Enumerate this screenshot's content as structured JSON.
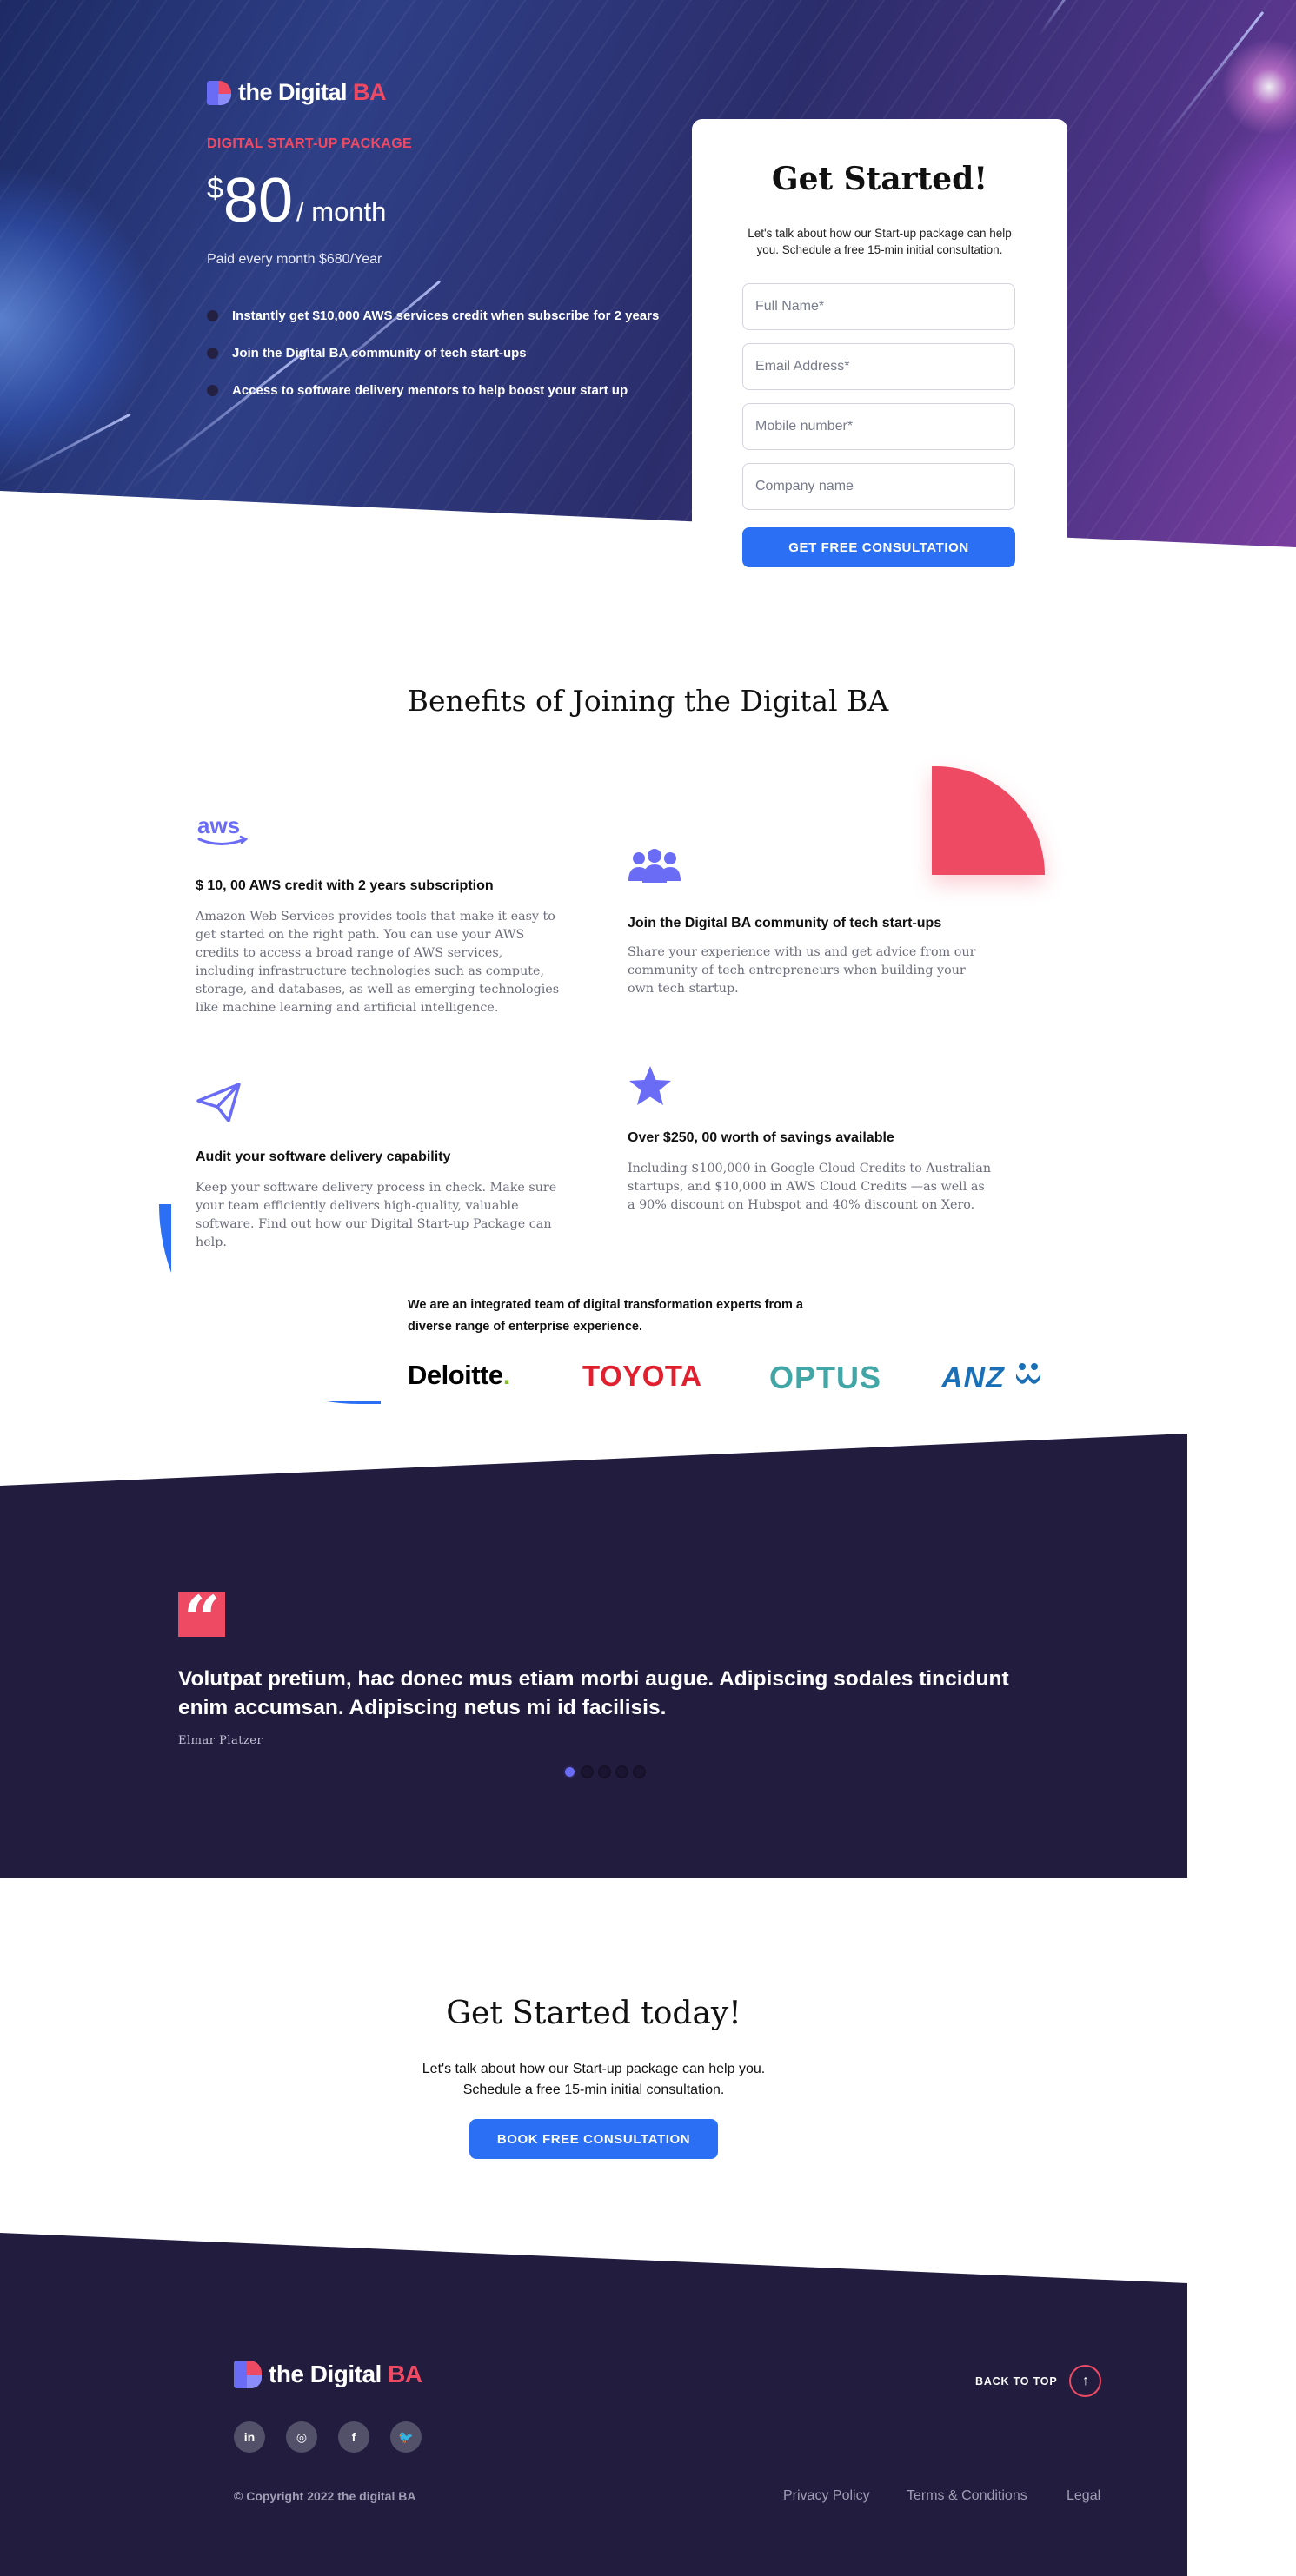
{
  "brand": {
    "name_main": "the Digital ",
    "name_accent": "BA"
  },
  "hero": {
    "eyebrow": "DIGITAL START-UP PACKAGE",
    "currency": "$",
    "amount": "80",
    "period": "/ month",
    "paid_note": "Paid every month $680/Year",
    "bullets": [
      "Instantly get $10,000 AWS services credit when subscribe for 2 years",
      "Join the Digital BA community of tech start-ups",
      "Access to software delivery mentors to help boost your start up"
    ]
  },
  "form": {
    "title": "Get Started!",
    "intro": "Let's talk about how our Start-up package can help you. Schedule a free 15-min initial consultation.",
    "full_name_placeholder": "Full Name*",
    "email_placeholder": "Email Address*",
    "mobile_placeholder": "Mobile number*",
    "company_placeholder": "Company name",
    "submit_label": "GET FREE CONSULTATION"
  },
  "benefits": {
    "title": "Benefits of Joining the Digital BA",
    "items": [
      {
        "icon": "aws-icon",
        "title": "$ 10, 00 AWS credit with 2 years subscription",
        "text": "Amazon Web Services provides tools that make it easy to get started on the right path. You can use your AWS credits to access a broad range of AWS services, including infrastructure technologies such as compute, storage, and databases, as well as emerging technologies like machine learning and artificial intelligence."
      },
      {
        "icon": "users-icon",
        "title": "Join the Digital BA community of tech start-ups",
        "text": "Share your experience with us and get advice from our community of tech entrepreneurs when building your own tech startup."
      },
      {
        "icon": "paper-plane-icon",
        "title": "Audit your software delivery capability",
        "text": "Keep your software delivery process in check. Make sure your team efficiently delivers high-quality, valuable software. Find out how our Digital Start-up Package can help."
      },
      {
        "icon": "star-icon",
        "title": "Over $250, 00 worth of savings available",
        "text": "Including $100,000 in Google Cloud Credits to Australian startups, and $10,000 in AWS Cloud Credits —as well as a 90% discount on Hubspot and 40% discount on Xero."
      }
    ]
  },
  "partners": {
    "text": "We are an integrated team of digital transformation experts from a diverse range of enterprise experience.",
    "logos": [
      "Deloitte",
      ".",
      "TOYOTA",
      "OPTUS",
      "ANZ"
    ]
  },
  "testimonial": {
    "quote": "Volutpat pretium, hac donec mus etiam morbi augue. Adipiscing sodales tincidunt enim accumsan. Adipiscing netus mi id facilisis.",
    "author": "Elmar Platzer",
    "slide_count": 5,
    "active_slide": 1
  },
  "cta": {
    "title": "Get Started today!",
    "line1": "Let's talk about how our Start-up package can help you.",
    "line2": "Schedule a free 15-min initial consultation.",
    "button": "BOOK FREE CONSULTATION"
  },
  "footer": {
    "back_to_top": "BACK TO TOP",
    "back_to_top_arrow": "↑",
    "socials": [
      {
        "name": "linkedin-icon",
        "glyph": "in"
      },
      {
        "name": "instagram-icon",
        "glyph": "◎"
      },
      {
        "name": "facebook-icon",
        "glyph": "f"
      },
      {
        "name": "twitter-icon",
        "glyph": "🐦"
      }
    ],
    "copyright": "© Copyright 2022 the digital BA",
    "links": [
      "Privacy Policy",
      "Terms & Conditions",
      "Legal"
    ]
  },
  "colors": {
    "accent_red": "#ef4a63",
    "primary_blue": "#2b6ff5",
    "icon_purple": "#6a6cf6",
    "dark_navy": "#221c3e"
  }
}
